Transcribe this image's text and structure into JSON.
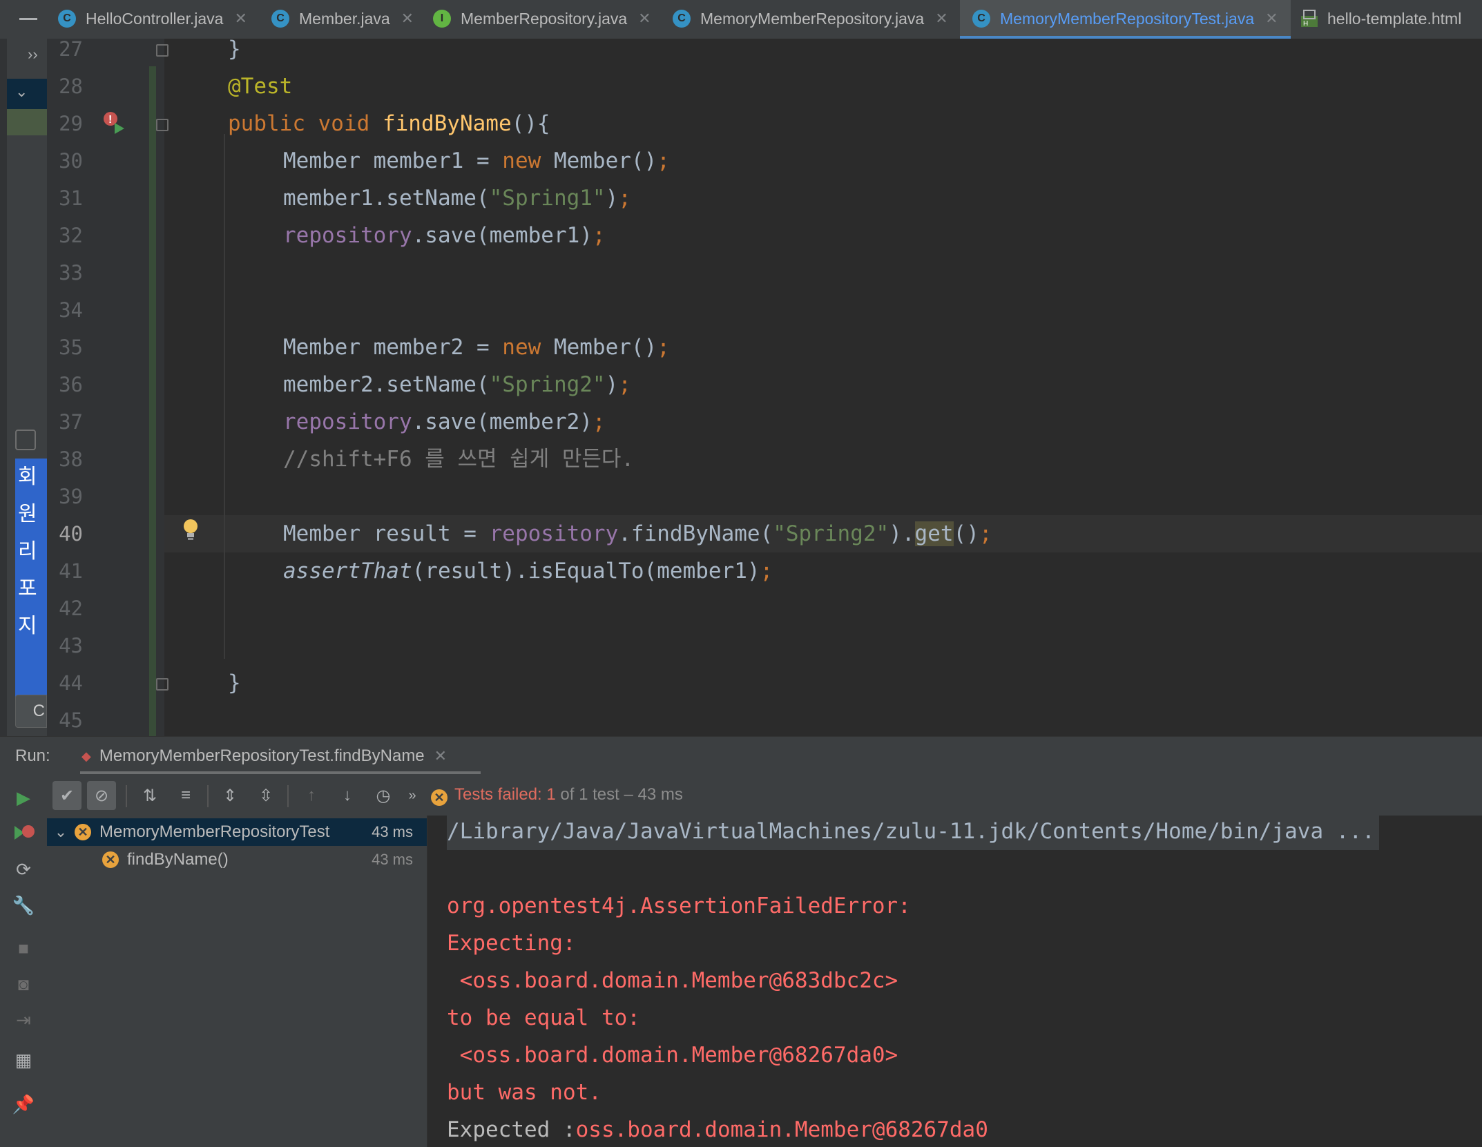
{
  "tabs": [
    {
      "label": "HelloController.java",
      "icon": "class-icon",
      "active": false
    },
    {
      "label": "Member.java",
      "icon": "class-icon",
      "active": false
    },
    {
      "label": "MemberRepository.java",
      "icon": "interface-icon",
      "active": false
    },
    {
      "label": "MemoryMemberRepository.java",
      "icon": "class-icon",
      "active": false
    },
    {
      "label": "MemoryMemberRepositoryTest.java",
      "icon": "test-class-icon",
      "active": true
    },
    {
      "label": "hello-template.html",
      "icon": "html-file-icon",
      "active": false
    }
  ],
  "project_panel": {
    "korean_text": "회원리포지",
    "button_label": "C"
  },
  "editor": {
    "line_numbers": [
      "27",
      "28",
      "29",
      "30",
      "31",
      "32",
      "33",
      "34",
      "35",
      "36",
      "37",
      "38",
      "39",
      "40",
      "41",
      "42",
      "43",
      "44",
      "45"
    ],
    "current_line": "40",
    "lines": {
      "l27": "}",
      "l28_ann": "@Test",
      "l29_kw": "public void ",
      "l29_fn": "findByName",
      "l29_rest": "(){",
      "l30_a": "Member member1 = ",
      "l30_kw": "new",
      "l30_b": " Member()",
      "l30_semi": ";",
      "l31_a": "member1.setName(",
      "l31_str": "\"Spring1\"",
      "l31_b": ")",
      "l31_semi": ";",
      "l32_fld": "repository",
      "l32_b": ".save(member1)",
      "l32_semi": ";",
      "l35_a": "Member member2 = ",
      "l35_kw": "new",
      "l35_b": " Member()",
      "l35_semi": ";",
      "l36_a": "member2.setName(",
      "l36_str": "\"Spring2\"",
      "l36_b": ")",
      "l36_semi": ";",
      "l37_fld": "repository",
      "l37_b": ".save(member2)",
      "l37_semi": ";",
      "l38_cmt": "//shift+F6 를 쓰면 쉽게 만든다.",
      "l40_a": "Member result = ",
      "l40_fld": "repository",
      "l40_b": ".findByName(",
      "l40_str": "\"Spring2\"",
      "l40_c": ").",
      "l40_hl": "get",
      "l40_d": "()",
      "l40_semi": ";",
      "l41_it": "assertThat",
      "l41_b": "(result).isEqualTo(member1)",
      "l41_semi": ";",
      "l44": "}"
    }
  },
  "run": {
    "label": "Run:",
    "config_tab": "MemoryMemberRepositoryTest.findByName",
    "status_failed": "Tests failed: 1",
    "status_rest": "of 1 test – 43 ms",
    "tree": [
      {
        "name": "MemoryMemberRepositoryTest",
        "time": "43 ms"
      },
      {
        "name": "findByName()",
        "time": "43 ms"
      }
    ],
    "console": {
      "command": "/Library/Java/JavaVirtualMachines/zulu-11.jdk/Contents/Home/bin/java ...",
      "lines": [
        "org.opentest4j.AssertionFailedError:",
        "Expecting:",
        " <oss.board.domain.Member@683dbc2c>",
        "to be equal to:",
        " <oss.board.domain.Member@68267da0>",
        "but was not."
      ],
      "expected_label": "Expected :",
      "expected_value": "oss.board.domain.Member@68267da0"
    }
  },
  "colors": {
    "keyword": "#cc7832",
    "function": "#ffc66d",
    "annotation": "#bbb529",
    "string": "#6a8759",
    "field": "#9876aa",
    "comment": "#808080",
    "error": "#ff6b68",
    "active_tab": "#589df6"
  }
}
